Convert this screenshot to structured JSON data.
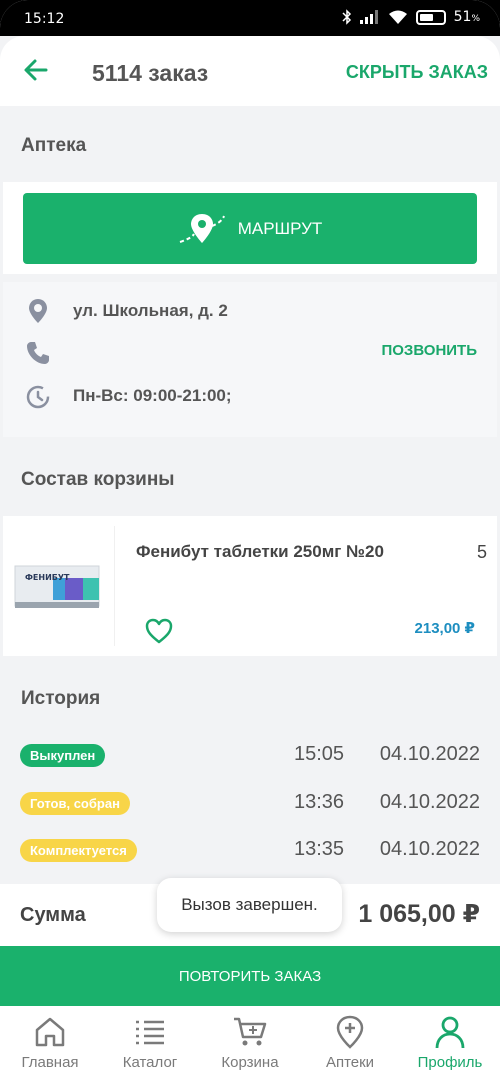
{
  "status_bar": {
    "time": "15:12",
    "battery_percent": "51",
    "battery_unit": "%"
  },
  "header": {
    "title": "5114 заказ",
    "hide_label": "СКРЫТЬ ЗАКАЗ"
  },
  "pharmacy": {
    "section_title": "Аптека",
    "route_label": "МАРШРУТ",
    "address": "ул. Школьная, д. 2",
    "call_label": "ПОЗВОНИТЬ",
    "hours": "Пн-Вс: 09:00-21:00;"
  },
  "cart": {
    "section_title": "Состав корзины",
    "items": [
      {
        "name": "Фенибут таблетки 250мг №20",
        "quantity": "5",
        "price": "213,00 ₽",
        "package_text": "ФЕНИБУТ"
      }
    ]
  },
  "history": {
    "section_title": "История",
    "entries": [
      {
        "status": "Выкуплен",
        "color": "#1ab16c",
        "time": "15:05",
        "date": "04.10.2022"
      },
      {
        "status": "Готов, собран",
        "color": "#f8d548",
        "time": "13:36",
        "date": "04.10.2022"
      },
      {
        "status": "Комплектуется",
        "color": "#f8d548",
        "time": "13:35",
        "date": "04.10.2022"
      }
    ]
  },
  "summary": {
    "label": "Сумма",
    "value": "1 065,00 ₽"
  },
  "toast": {
    "text": "Вызов завершен."
  },
  "repeat_label": "ПОВТОРИТЬ ЗАКАЗ",
  "tabs": [
    {
      "label": "Главная",
      "icon": "home-icon",
      "active": false
    },
    {
      "label": "Каталог",
      "icon": "list-icon",
      "active": false
    },
    {
      "label": "Корзина",
      "icon": "cart-icon",
      "active": false
    },
    {
      "label": "Аптеки",
      "icon": "pharmacy-pin-icon",
      "active": false
    },
    {
      "label": "Профиль",
      "icon": "profile-icon",
      "active": true
    }
  ],
  "colors": {
    "accent": "#1ab16c",
    "price_blue": "#1d8ec0",
    "pending_yellow": "#f8d548"
  }
}
